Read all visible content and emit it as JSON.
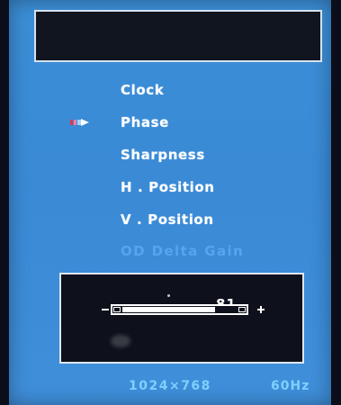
{
  "osd": {
    "menu": [
      {
        "label": "Clock",
        "selected": false,
        "enabled": true
      },
      {
        "label": "Phase",
        "selected": true,
        "enabled": true
      },
      {
        "label": "Sharpness",
        "selected": false,
        "enabled": true
      },
      {
        "label": "H . Position",
        "selected": false,
        "enabled": true
      },
      {
        "label": "V . Position",
        "selected": false,
        "enabled": true
      },
      {
        "label": "OD Delta Gain",
        "selected": false,
        "enabled": false
      }
    ],
    "selector_icon": "arrow-right-icon",
    "slider": {
      "value": "81",
      "level": 0.81,
      "minus_icon": "minus-icon",
      "plus_icon": "plus-icon"
    },
    "status": {
      "resolution": "1024×768",
      "frequency": "60Hz"
    },
    "colors": {
      "panel_blue": "#3b8ed6",
      "box_black": "#11151f",
      "text_white": "#ffffff",
      "disabled_text": "#5aa8ef",
      "status_text": "#7fd0ff"
    }
  }
}
